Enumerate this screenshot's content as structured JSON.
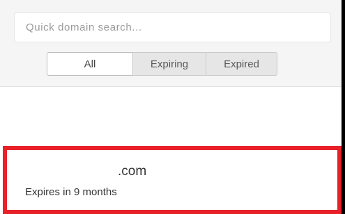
{
  "search": {
    "placeholder": "Quick domain search..."
  },
  "filters": {
    "all": "All",
    "expiring": "Expiring",
    "expired": "Expired",
    "selected": "All"
  },
  "domains": [
    {
      "name": ".com",
      "expiry": "Expires in 9 months"
    }
  ],
  "colors": {
    "highlight": "#e8202a",
    "toolbar_bg": "#f5f5f5"
  }
}
